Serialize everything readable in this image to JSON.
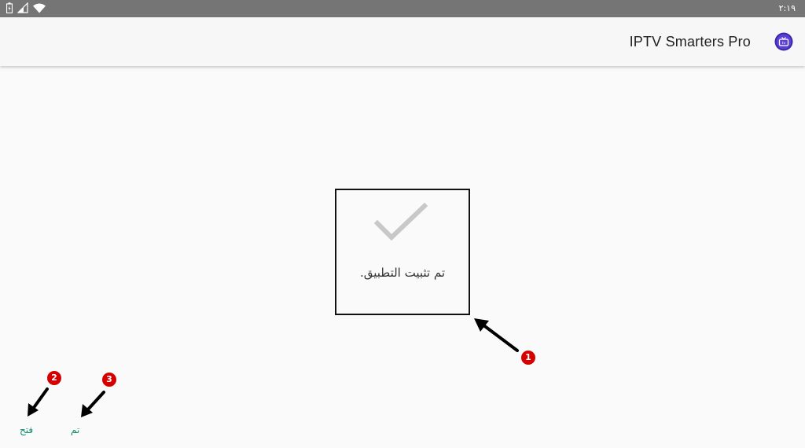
{
  "status_bar": {
    "time": "٢:١٩",
    "icons": [
      "battery-icon",
      "signal-icon",
      "wifi-icon"
    ]
  },
  "app_bar": {
    "title": "IPTV Smarters Pro",
    "icon": "app-logo-icon"
  },
  "dialog": {
    "message": "تم تثبيت التطبيق.",
    "icon": "checkmark-icon"
  },
  "actions": {
    "open_label": "فتح",
    "done_label": "تم"
  },
  "annotations": {
    "badge_1": "1",
    "badge_2": "2",
    "badge_3": "3"
  },
  "colors": {
    "status_bar": "#757575",
    "accent": "#0d8a6d",
    "badge": "#d40000",
    "app_icon": "#3a2aa8"
  }
}
